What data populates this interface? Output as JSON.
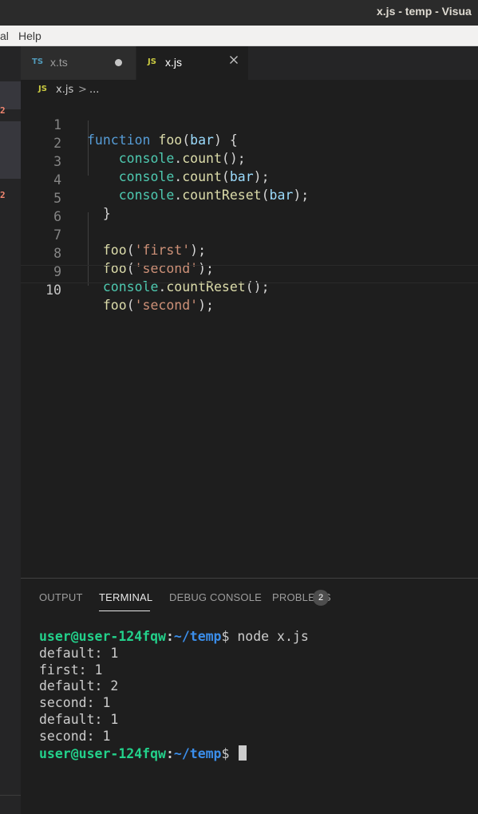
{
  "window": {
    "title": "x.js - temp - Visua"
  },
  "menu": {
    "items": [
      "al",
      "Help"
    ]
  },
  "sidebar": {
    "error_badges": [
      "2",
      "2"
    ]
  },
  "tabs": [
    {
      "lang": "TS",
      "name": "x.ts",
      "modified": true
    },
    {
      "lang": "JS",
      "name": "x.js",
      "active": true
    }
  ],
  "breadcrumb": {
    "lang": "JS",
    "file": "x.js",
    "separator": ">",
    "rest": "..."
  },
  "editor": {
    "line_numbers": [
      "1",
      "2",
      "3",
      "4",
      "5",
      "6",
      "7",
      "8",
      "9",
      "10"
    ],
    "current_line": 10
  },
  "panel": {
    "tabs": [
      "OUTPUT",
      "TERMINAL",
      "DEBUG CONSOLE",
      "PROBLEMS"
    ],
    "active_tab": "TERMINAL",
    "problems_count": "2"
  },
  "terminal": {
    "prompt_user": "user@user-124fqw",
    "prompt_colon": ":",
    "prompt_path": "~/temp",
    "prompt_suffix": "$ ",
    "command": "node x.js",
    "output": [
      "default: 1",
      "first: 1",
      "default: 2",
      "second: 1",
      "default: 1",
      "second: 1"
    ]
  },
  "colors": {
    "editor_bg": "#1e1e1e",
    "keyword": "#569cd6",
    "function": "#dcdcaa",
    "variable": "#9cdcfe",
    "class": "#4ec9b0",
    "string": "#ce9178",
    "terminal_user": "#23d18b",
    "terminal_path": "#3b8eea"
  }
}
